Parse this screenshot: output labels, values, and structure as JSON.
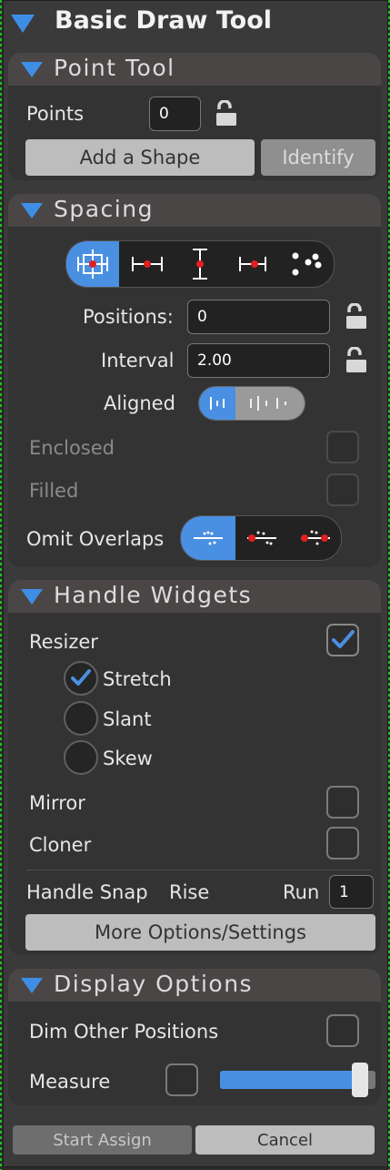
{
  "header": {
    "title": "Basic Draw Tool"
  },
  "point_tool": {
    "title": "Point Tool",
    "points_label": "Points",
    "points_value": "0",
    "add_shape": "Add a Shape",
    "identify": "Identify"
  },
  "spacing": {
    "title": "Spacing",
    "positions_label": "Positions:",
    "positions_value": "0",
    "interval_label": "Interval",
    "interval_value": "2.00",
    "aligned_label": "Aligned",
    "enclosed_label": "Enclosed",
    "filled_label": "Filled",
    "omit_label": "Omit Overlaps"
  },
  "handle_widgets": {
    "title": "Handle Widgets",
    "resizer_label": "Resizer",
    "stretch_label": "Stretch",
    "slant_label": "Slant",
    "skew_label": "Skew",
    "mirror_label": "Mirror",
    "cloner_label": "Cloner",
    "handle_snap_label": "Handle Snap",
    "rise_label": "Rise",
    "run_label": "Run",
    "run_value": "1",
    "more_options": "More Options/Settings"
  },
  "display": {
    "title": "Display Options",
    "dim_label": "Dim Other Positions",
    "measure_label": "Measure",
    "measure_level": 0.95
  },
  "footer": {
    "start_assign": "Start Assign",
    "cancel": "Cancel"
  },
  "colors": {
    "accent": "#4a90e2",
    "handle_dot": "#e02020"
  }
}
